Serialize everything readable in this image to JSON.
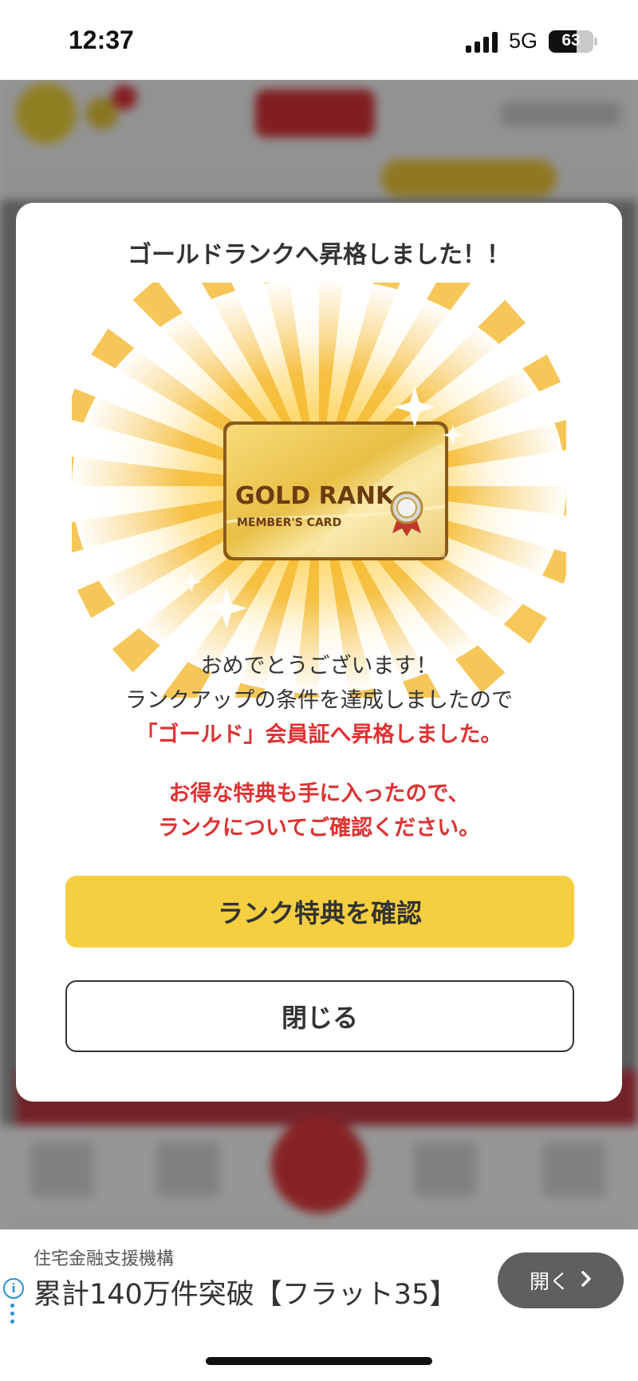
{
  "status_bar": {
    "time": "12:37",
    "network": "5G",
    "battery": "63",
    "battery_level": 0.63
  },
  "modal": {
    "title": "ゴールドランクへ昇格しました！！",
    "card_line1": "GOLD RANK",
    "card_line2": "MEMBER'S CARD",
    "message_line1": "おめでとうございます！",
    "message_line2": "ランクアップの条件を達成しましたので",
    "message_line3": "「ゴールド」会員証へ昇格しました。",
    "notice_line1": "お得な特典も手に入ったので、",
    "notice_line2": "ランクについてご確認ください。",
    "primary_button": "ランク特典を確認",
    "close_button": "閉じる"
  },
  "ad": {
    "sponsor": "住宅金融支援機構",
    "headline": "累計140万件突破【フラット35】",
    "open_label": "開く",
    "open_icon": "chevron-right-icon"
  },
  "colors": {
    "primary_button": "#f5cf3f",
    "alert_text": "#dd3333",
    "ad_button": "#5f5f5f"
  }
}
